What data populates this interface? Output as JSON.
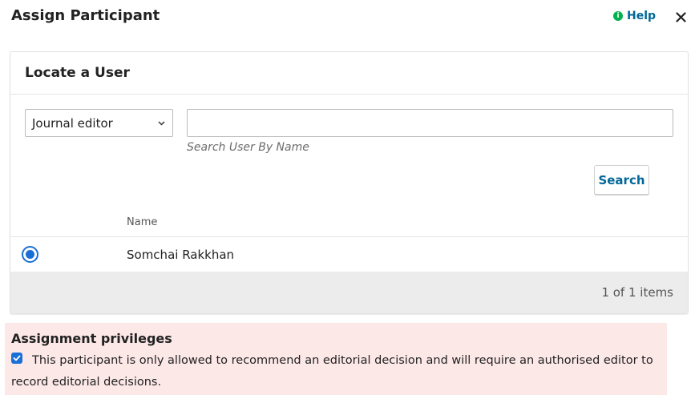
{
  "header": {
    "title": "Assign Participant",
    "help_label": "Help",
    "help_icon": "info-icon",
    "close_icon": "close-icon"
  },
  "locate_panel": {
    "title": "Locate a User",
    "role_select": {
      "selected": "Journal editor",
      "icon": "chevron-down-icon"
    },
    "search_input": {
      "value": "",
      "hint": "Search User By Name"
    },
    "search_button_label": "Search",
    "table": {
      "columns": [
        "Name"
      ],
      "rows": [
        {
          "name": "Somchai Rakkhan",
          "selected": true
        }
      ]
    },
    "pager_text": "1 of 1 items"
  },
  "privileges": {
    "title": "Assignment privileges",
    "checked": true,
    "text": "This participant is only allowed to recommend an editorial decision and will require an authorised editor to record editorial decisions."
  },
  "colors": {
    "link": "#006798",
    "accent": "#1a6fd6",
    "warning_bg": "#fde8e8",
    "help_icon": "#00b24e"
  }
}
